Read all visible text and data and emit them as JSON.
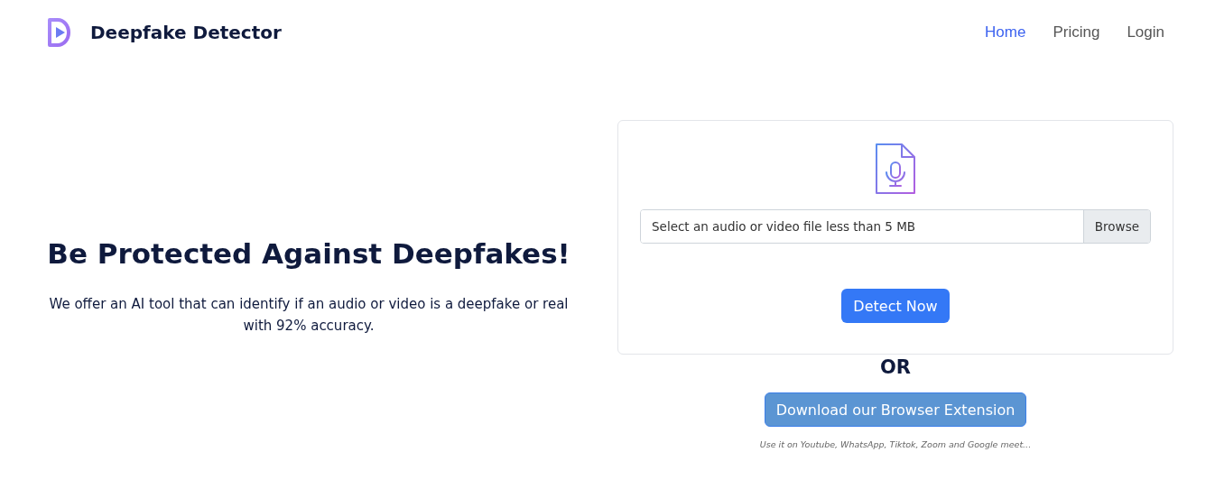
{
  "brand": {
    "name": "Deepfake Detector"
  },
  "nav": [
    {
      "label": "Home",
      "selected": true
    },
    {
      "label": "Pricing",
      "selected": false
    },
    {
      "label": "Login",
      "selected": false
    }
  ],
  "hero": {
    "title": "Be Protected Against Deepfakes!",
    "description": "We offer an AI tool that can identify if an audio or video is a deepfake or real with 92% accuracy."
  },
  "upload": {
    "placeholder": "Select an audio or video file less than 5 MB",
    "browse_label": "Browse",
    "submit_label": "Detect Now"
  },
  "divider_text": "OR",
  "extension": {
    "button_label": "Download our Browser Extension",
    "note": "Use it on Youtube, WhatsApp, Tiktok, Zoom and Google meet..."
  }
}
